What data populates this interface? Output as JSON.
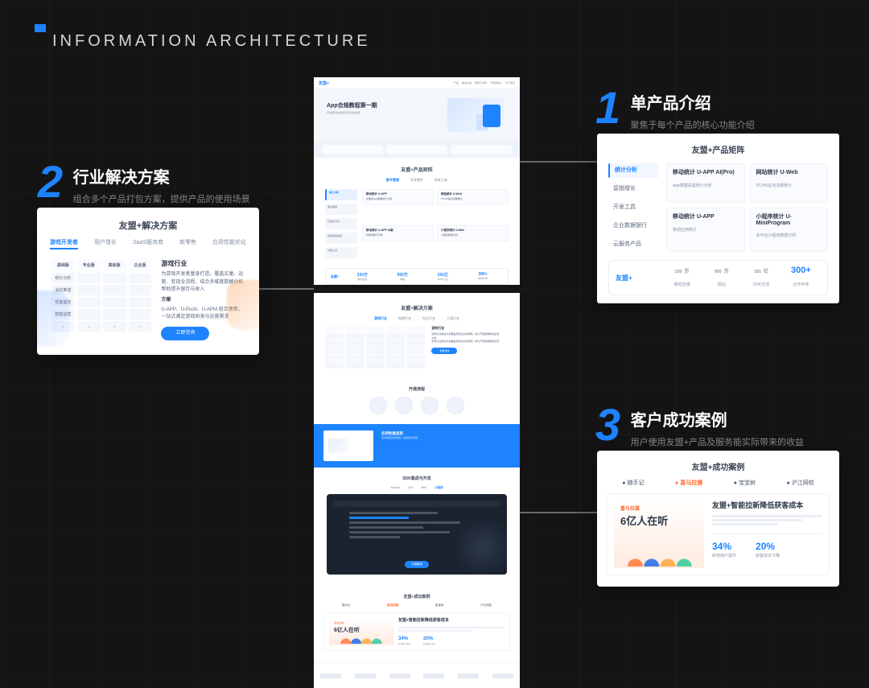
{
  "page_heading": "INFORMATION ARCHITECTURE",
  "callouts": {
    "c1": {
      "num": "1",
      "title": "单产品介绍",
      "sub": "聚焦于每个产品的核心功能介绍"
    },
    "c2": {
      "num": "2",
      "title": "行业解决方案",
      "sub": "组合多个产品打包方案，提供产品的使用场景"
    },
    "c3": {
      "num": "3",
      "title": "客户成功案例",
      "sub": "用户使用友盟+产品及服务能实际带来的收益"
    }
  },
  "center": {
    "brand": "友盟+",
    "nav": [
      "产品",
      "解决方案",
      "服务与支持",
      "开发者中心",
      "关于我们"
    ],
    "hero_title": "App合规教程第一期",
    "hero_sub": "开发者隐私合规自查与整改指南",
    "products_title": "友盟+产品矩阵",
    "products_tabs": [
      "数字营销",
      "开发套件",
      "研发工具"
    ],
    "side_items": [
      "统计分析",
      "消息推送",
      "社会化分享",
      "应用性能监控",
      "智能认证"
    ],
    "cards": [
      {
        "t": "移动统计 U-APP",
        "s": "全面的App数据统计分析"
      },
      {
        "t": "网站统计 U-Web",
        "s": "PC/H5站点流量统计"
      },
      {
        "t": "移动统计 U-APP AI版",
        "s": "智能洞察与分析"
      },
      {
        "t": "小程序统计 U-Mini",
        "s": "小程序数据分析"
      }
    ],
    "stats_brand": "友盟+",
    "stats": [
      {
        "v": "230",
        "u": "万",
        "l": "移动应用"
      },
      {
        "v": "950",
        "u": "万",
        "l": "网站"
      },
      {
        "v": "191",
        "u": "亿",
        "l": "SDK日活"
      },
      {
        "v": "300+",
        "u": "",
        "l": "合作伙伴"
      }
    ],
    "sol_title": "友盟+解决方案",
    "sol_tabs": [
      "游戏行业",
      "电商行业",
      "社交行业",
      "工具行业"
    ],
    "sol_desc_t": "游戏行业",
    "sol_desc_b": "游戏行业解决方案覆盖游戏全生命周期，助力开发者精细化运营",
    "sol_sub": "方案",
    "sol_btn": "查看详情",
    "proc_title": "开通流程",
    "blue_title": "应用性能监控",
    "blue_sub": "实时监控应用性能，快速定位问题",
    "dark_title": "SDK集成与开发",
    "dark_tabs": [
      "Android",
      "iOS",
      "Web",
      "小程序"
    ],
    "dark_btn": "开始集成",
    "case_title": "友盟+成功案例",
    "case_brands": [
      "随手记",
      "喜马拉雅",
      "宝宝树",
      "沪江网校"
    ],
    "case_kicker": "喜马拉雅",
    "case_big": "6亿人在听",
    "case_heading": "友盟+智能拉新降低获客成本",
    "case_metrics": [
      {
        "v": "34%",
        "l": "新增用户提升"
      },
      {
        "v": "20%",
        "l": "获客成本下降"
      }
    ]
  },
  "card1": {
    "title": "友盟+产品矩阵",
    "side": [
      "统计分析",
      "营销增长",
      "开发工具",
      "企业数据银行",
      "云服务产品"
    ],
    "cells": [
      {
        "t": "移动统计 U-APP AI(Pro)",
        "s": "App数据采集统计分析"
      },
      {
        "t": "网站统计 U-Web",
        "s": "PC/H5站点流量统计"
      },
      {
        "t": "移动统计 U-APP",
        "s": "移动应用统计"
      },
      {
        "t": "小程序统计 U-MiniProgram",
        "s": "多平台小程序数据分析"
      }
    ],
    "brand": "友盟+",
    "stats": [
      {
        "v": "230",
        "u": "万",
        "l": "移动应用"
      },
      {
        "v": "950",
        "u": "万",
        "l": "网站"
      },
      {
        "v": "191",
        "u": "亿",
        "l": "SDK日活"
      },
      {
        "v": "300+",
        "u": "",
        "l": "合作伙伴"
      }
    ]
  },
  "card2": {
    "title": "友盟+解决方案",
    "tabs": [
      "游戏开发者",
      "用户增长",
      "SaaS服务商",
      "新零售",
      "应用性能优化"
    ],
    "plan_heads": [
      "基础版",
      "专业版",
      "高级版",
      "企业版"
    ],
    "plan_rows": [
      "统计分析",
      "消息推送",
      "性能监控",
      "智能运营",
      "↓"
    ],
    "desc_t": "游戏行业",
    "desc_b": "为游戏开发者量身打造，覆盖买量、运营、变现全流程，结合多维度数据分析帮助提升留存与收入",
    "desc_sub": "方案",
    "desc_b2": "U-APP、U-Push、U-APM 组合使用，一站式满足游戏研发与运营需求",
    "btn": "立即咨询"
  },
  "card3": {
    "title": "友盟+成功案例",
    "brands": [
      "随手记",
      "喜马拉雅",
      "宝宝树",
      "沪江网校"
    ],
    "kicker": "喜马拉雅",
    "big": "6亿人在听",
    "heading": "友盟+智能拉新降低获客成本",
    "metrics": [
      {
        "v": "34%",
        "l": "新增用户提升"
      },
      {
        "v": "20%",
        "l": "获客成本下降"
      }
    ]
  }
}
